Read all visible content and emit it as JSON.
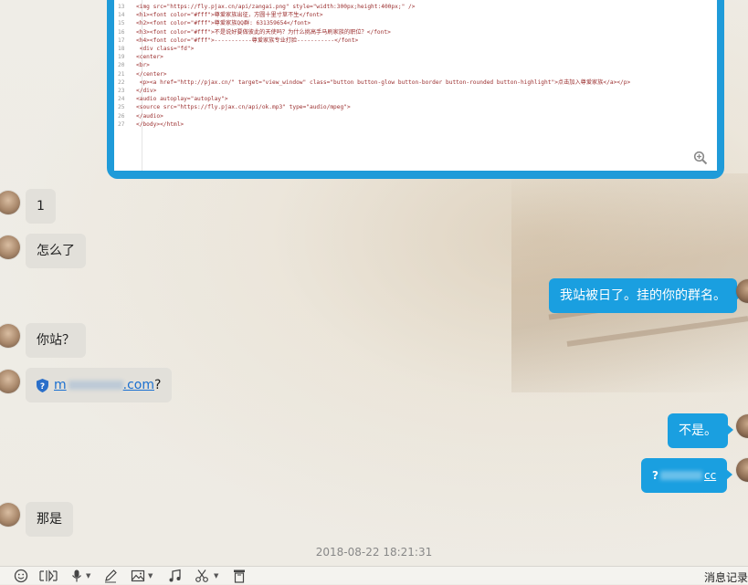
{
  "code_panel": {
    "lines": [
      {
        "no": "13",
        "text": "<img src=\"https://fly.pjax.cn/api/zangai.png\" style=\"width:300px;height:400px;\" />"
      },
      {
        "no": "14",
        "text": "<h1><font  color=\"#fff\">尊爱家族出征，方圆十里寸草不生</font>"
      },
      {
        "no": "15",
        "text": "<h2><font  color=\"#fff\">尊爱家族QQ群: 631359654</font>"
      },
      {
        "no": "16",
        "text": "<h3><font  color=\"#fff\">不是说好要做彼此的天使吗？为什么挑高手马刷家族的职位？</font>"
      },
      {
        "no": "17",
        "text": "<h4><font  color=\"#fff\">-----------尊爱家族专业打脸-----------</font>"
      },
      {
        "no": "18",
        "text": "    <div class=\"fd\">"
      },
      {
        "no": "19",
        "text": "<center>"
      },
      {
        "no": "20",
        "text": "<br>"
      },
      {
        "no": "21",
        "text": "</center>"
      },
      {
        "no": "22",
        "text": "    <p><a href=\"http://pjax.cn/\"  target=\"view_window\" class=\"button button-glow button-border button-rounded button-highlight\">点击加入尊爱家族</a></p>"
      },
      {
        "no": "23",
        "text": "</div>"
      },
      {
        "no": "24",
        "text": "<audio autoplay=\"autoplay\">"
      },
      {
        "no": "25",
        "text": "<source src=\"https://fly.pjax.cn/api/ok.mp3\" type=\"audio/mpeg\">"
      },
      {
        "no": "26",
        "text": "</audio>"
      },
      {
        "no": "27",
        "text": "</body></html>"
      }
    ]
  },
  "messages": {
    "m1": "1",
    "m2": "怎么了",
    "m3": "我站被日了。挂的你的群名。",
    "m4": "你站？",
    "m5_prefix": "m",
    "m5_domain": ".com",
    "m5_suffix": "?",
    "m6": "不是。",
    "m7_prefix": "?",
    "m7_domain": "cc",
    "m8": "那是"
  },
  "timestamp": "2018-08-22 18:21:31",
  "toolbar": {
    "history_label": "消息记录",
    "icons": [
      "smiley-icon",
      "screenshot-icon",
      "microphone-icon",
      "pen-icon",
      "image-icon",
      "music-icon",
      "scissors-icon",
      "trash-icon"
    ]
  },
  "colors": {
    "outgoing_bubble": "#1a9fe0",
    "incoming_bubble": "#e2e0da",
    "code_frame": "#1f9bd9"
  }
}
